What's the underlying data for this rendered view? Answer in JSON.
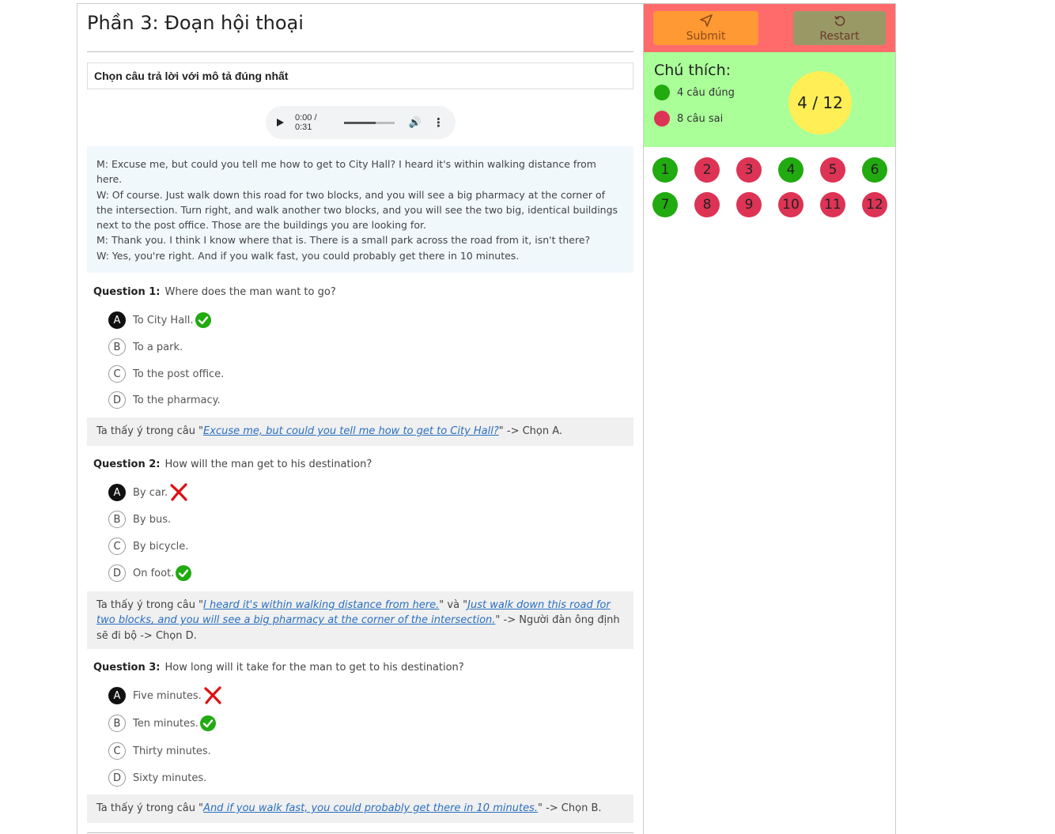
{
  "main": {
    "title": "Phần 3: Đoạn hội thoại",
    "instruction": "Chọn câu trả lời với mô tả đúng nhất",
    "audio": {
      "time": "0:00 / 0:31",
      "progress_fraction": 0.63
    },
    "transcript": [
      "M: Excuse me, but could you tell me how to get to City Hall? I heard it's within walking distance from here.",
      "W: Of course. Just walk down this road for two blocks, and you will see a big pharmacy at the corner of the intersection. Turn right, and walk another two blocks, and you will see the two big, identical buildings next to the post office. Those are the buildings you are looking for.",
      "M: Thank you. I think I know where that is. There is a small park across the road from it, isn't there?",
      "W: Yes, you're right. And if you walk fast, you could probably get there in 10 minutes."
    ],
    "questions": [
      {
        "label": "Question 1:",
        "text": "Where does the man want to go?",
        "options": [
          {
            "letter": "A",
            "text": "To City Hall.",
            "selected": true,
            "mark": "correct"
          },
          {
            "letter": "B",
            "text": "To a park.",
            "selected": false,
            "mark": ""
          },
          {
            "letter": "C",
            "text": "To the post office.",
            "selected": false,
            "mark": ""
          },
          {
            "letter": "D",
            "text": "To the pharmacy.",
            "selected": false,
            "mark": ""
          }
        ],
        "explanation": {
          "prefix": "Ta thấy ý trong câu \"",
          "quote1": "Excuse me, but could you tell me how to get to City Hall?",
          "mid": "",
          "quote2": "",
          "suffix": "\" -> Chọn A."
        }
      },
      {
        "label": "Question 2:",
        "text": "How will the man get to his destination?",
        "options": [
          {
            "letter": "A",
            "text": "By car.",
            "selected": true,
            "mark": "wrong"
          },
          {
            "letter": "B",
            "text": "By bus.",
            "selected": false,
            "mark": ""
          },
          {
            "letter": "C",
            "text": "By bicycle.",
            "selected": false,
            "mark": ""
          },
          {
            "letter": "D",
            "text": "On foot.",
            "selected": false,
            "mark": "correct"
          }
        ],
        "explanation": {
          "prefix": "Ta thấy ý trong câu \"",
          "quote1": "I heard it's within walking distance from here.",
          "mid": "\" và \"",
          "quote2": "Just walk down this road for two blocks, and you will see a big pharmacy at the corner of the intersection.",
          "suffix": "\" -> Người đàn ông định sẽ đi bộ -> Chọn D."
        }
      },
      {
        "label": "Question 3:",
        "text": "How long will it take for the man to get to his destination?",
        "options": [
          {
            "letter": "A",
            "text": "Five minutes.",
            "selected": true,
            "mark": "wrong"
          },
          {
            "letter": "B",
            "text": "Ten minutes.",
            "selected": false,
            "mark": "correct"
          },
          {
            "letter": "C",
            "text": "Thirty minutes.",
            "selected": false,
            "mark": ""
          },
          {
            "letter": "D",
            "text": "Sixty minutes.",
            "selected": false,
            "mark": ""
          }
        ],
        "explanation": {
          "prefix": "Ta thấy ý trong câu \"",
          "quote1": "And if you walk fast, you could probably get there in 10 minutes.",
          "mid": "",
          "quote2": "",
          "suffix": "\" -> Chọn B."
        }
      }
    ]
  },
  "sidebar": {
    "submit_label": "Submit",
    "restart_label": "Restart",
    "legend_title": "Chú thích:",
    "correct_label": "4 câu đúng",
    "wrong_label": "8 câu sai",
    "score": "4 / 12",
    "colors": {
      "topbar": "#ff6b6b",
      "submit": "#ff9933",
      "restart": "#999966",
      "legend_bg": "#aaff99",
      "score_bg": "#ffee55",
      "correct": "#22aa11",
      "wrong": "#dd3355"
    },
    "numbers": [
      {
        "n": "1",
        "status": "correct"
      },
      {
        "n": "2",
        "status": "wrong"
      },
      {
        "n": "3",
        "status": "wrong"
      },
      {
        "n": "4",
        "status": "correct"
      },
      {
        "n": "5",
        "status": "wrong"
      },
      {
        "n": "6",
        "status": "correct"
      },
      {
        "n": "7",
        "status": "correct"
      },
      {
        "n": "8",
        "status": "wrong"
      },
      {
        "n": "9",
        "status": "wrong"
      },
      {
        "n": "10",
        "status": "wrong"
      },
      {
        "n": "11",
        "status": "wrong"
      },
      {
        "n": "12",
        "status": "wrong"
      }
    ]
  }
}
